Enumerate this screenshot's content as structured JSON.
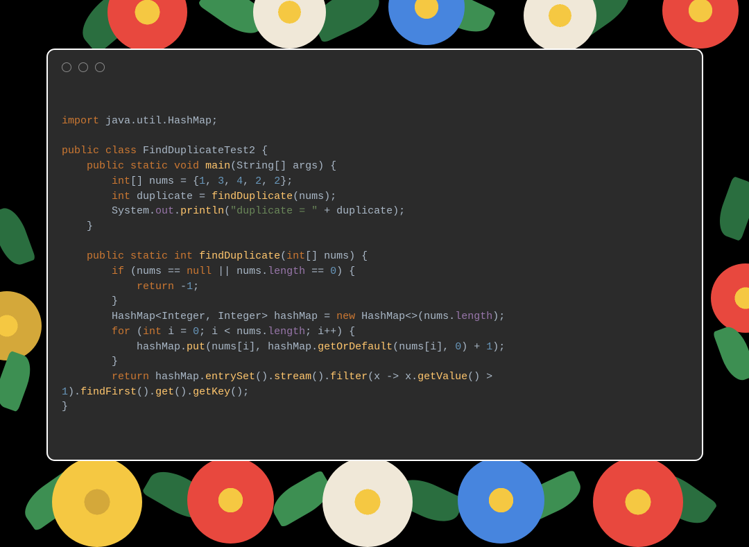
{
  "code": {
    "l1_import": "import",
    "l1_pkg": " java.util.HashMap",
    "l1_semi": ";",
    "l2_public": "public",
    "l2_class": " class",
    "l2_name": " FindDuplicateTest2 ",
    "l2_brace": "{",
    "l3_indent": "    ",
    "l3_public": "public",
    "l3_static": " static",
    "l3_void": " void",
    "l3_main": " main",
    "l3_paren1": "(",
    "l3_string": "String",
    "l3_arr": "[] ",
    "l3_args": "args",
    "l3_paren2": ") {",
    "l4_indent": "        ",
    "l4_int": "int",
    "l4_arr": "[] ",
    "l4_nums": "nums = {",
    "l4_n1": "1",
    "l4_c1": ", ",
    "l4_n2": "3",
    "l4_c2": ", ",
    "l4_n3": "4",
    "l4_c3": ", ",
    "l4_n4": "2",
    "l4_c4": ", ",
    "l4_n5": "2",
    "l4_end": "};",
    "l5_indent": "        ",
    "l5_int": "int",
    "l5_dup": " duplicate = ",
    "l5_fn": "findDuplicate",
    "l5_p1": "(",
    "l5_arg": "nums",
    "l5_p2": ");",
    "l6_indent": "        ",
    "l6_sys": "System.",
    "l6_out": "out",
    "l6_dot": ".",
    "l6_println": "println",
    "l6_p1": "(",
    "l6_str": "\"duplicate = \"",
    "l6_plus": " + ",
    "l6_dup": "duplicate",
    "l6_p2": ");",
    "l7_close": "    }",
    "l8_indent": "    ",
    "l8_public": "public",
    "l8_static": " static",
    "l8_int": " int",
    "l8_fn": " findDuplicate",
    "l8_p1": "(",
    "l8_int2": "int",
    "l8_arr": "[] ",
    "l8_nums": "nums",
    "l8_p2": ") {",
    "l9_indent": "        ",
    "l9_if": "if",
    "l9_p1": " (",
    "l9_nums": "nums == ",
    "l9_null": "null",
    "l9_or": " || ",
    "l9_numslen": "nums.",
    "l9_len": "length",
    "l9_eq": " == ",
    "l9_zero": "0",
    "l9_p2": ") {",
    "l10_indent": "            ",
    "l10_return": "return",
    "l10_neg1": " -",
    "l10_one": "1",
    "l10_semi": ";",
    "l11_close": "        }",
    "l12_indent": "        ",
    "l12_hm": "HashMap",
    "l12_lt": "<",
    "l12_int1": "Integer",
    "l12_c": ", ",
    "l12_int2": "Integer",
    "l12_gt": "> ",
    "l12_var": "hashMap = ",
    "l12_new": "new",
    "l12_hm2": " HashMap",
    "l12_dia": "<>(",
    "l12_nums": "nums.",
    "l12_len": "length",
    "l12_end": ");",
    "l13_indent": "        ",
    "l13_for": "for",
    "l13_p1": " (",
    "l13_int": "int",
    "l13_i": " i = ",
    "l13_zero": "0",
    "l13_semi1": "; ",
    "l13_cond": "i < nums.",
    "l13_len": "length",
    "l13_semi2": "; ",
    "l13_inc": "i++) {",
    "l14_indent": "            ",
    "l14_hm": "hashMap.",
    "l14_put": "put",
    "l14_p1": "(",
    "l14_nums": "nums[",
    "l14_i1": "i",
    "l14_b1": "], ",
    "l14_hm2": "hashMap.",
    "l14_god": "getOrDefault",
    "l14_p2": "(",
    "l14_nums2": "nums[",
    "l14_i2": "i",
    "l14_b2": "], ",
    "l14_zero": "0",
    "l14_p3": ") + ",
    "l14_one": "1",
    "l14_end": ");",
    "l15_close": "        }",
    "l16_indent": "        ",
    "l16_return": "return",
    "l16_hm": " hashMap.",
    "l16_es": "entrySet",
    "l16_p1": "().",
    "l16_stream": "stream",
    "l16_p2": "().",
    "l16_filter": "filter",
    "l16_p3": "(",
    "l16_x": "x -> x.",
    "l16_gv": "getValue",
    "l16_p4": "() > ",
    "l17_one": "1",
    "l17_p1": ").",
    "l17_ff": "findFirst",
    "l17_p2": "().",
    "l17_get": "get",
    "l17_p3": "().",
    "l17_gk": "getKey",
    "l17_end": "();",
    "l18_close": "}"
  }
}
